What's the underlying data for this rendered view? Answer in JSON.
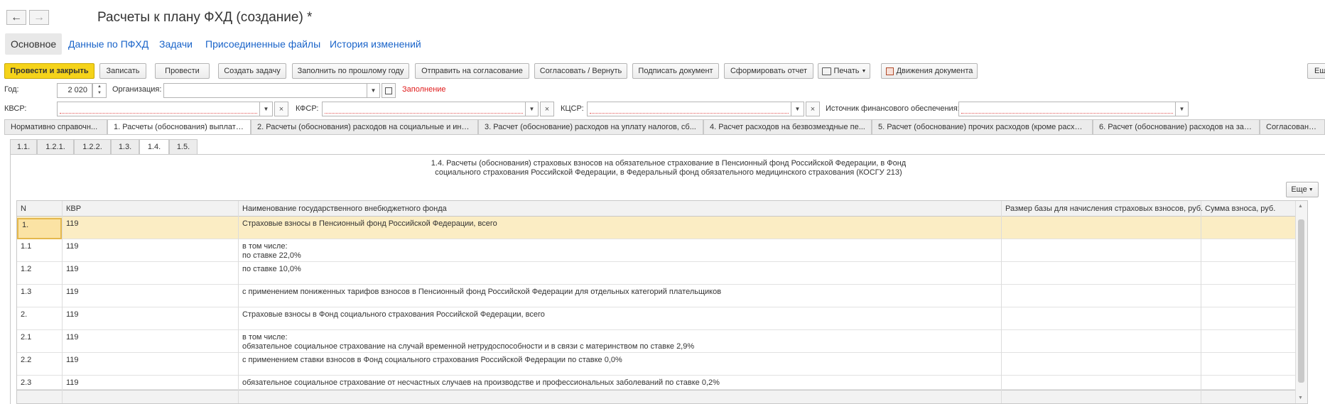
{
  "window": {
    "title": "Расчеты к плану ФХД (создание) *",
    "back_icon": "←",
    "forward_icon": "→"
  },
  "top_tabs": [
    "Основное",
    "Данные по ПФХД",
    "Задачи",
    "Присоединенные файлы",
    "История изменений"
  ],
  "toolbar": {
    "post_close": "Провести и закрыть",
    "save": "Записать",
    "post": "Провести",
    "create_task": "Создать задачу",
    "fill_prev_year": "Заполнить по прошлому году",
    "send_approval": "Отправить на согласование",
    "approve_return": "Согласовать / Вернуть",
    "sign": "Подписать документ",
    "report": "Сформировать отчет",
    "print": "Печать",
    "movements": "Движения документа",
    "more": "Ещ"
  },
  "fields": {
    "year_label": "Год:",
    "year_value": "2 020",
    "org_label": "Организация:",
    "org_value": "",
    "fill_link": "Заполнение",
    "kvsr_label": "КВСР:",
    "kfsr_label": "КФСР:",
    "kcsr_label": "КЦСР:",
    "source_label": "Источник финансового обеспечения:"
  },
  "section_tabs": [
    "Нормативно справочн...",
    "1. Расчеты (обоснования) выплат п...",
    "2. Расчеты (обоснования) расходов на социальные и ины...",
    "3. Расчет (обоснование) расходов на уплату налогов, сб...",
    "4. Расчет расходов на безвозмездные пе...",
    "5. Расчет (обоснование) прочих расходов (кроме расход...",
    "6. Расчет (обоснование) расходов на зак...",
    "Согласован поль..."
  ],
  "sub_tabs": [
    "1.1.",
    "1.2.1.",
    "1.2.2.",
    "1.3.",
    "1.4.",
    "1.5."
  ],
  "caption": {
    "line1": "1.4. Расчеты (обоснования) страховых взносов на обязательное страхование в Пенсионный фонд Российской Федерации, в Фонд",
    "line2": "социального страхования Российской Федерации, в Федеральный фонд обязательного медицинского страхования (КОСГУ 213)"
  },
  "more_button": "Еще",
  "table": {
    "columns": [
      "N",
      "КВР",
      "Наименование государственного внебюджетного фонда",
      "Размер базы для начисления страховых взносов, руб.",
      "Сумма взноса, руб."
    ],
    "rows": [
      {
        "n": "1.",
        "kvr": "119",
        "name": "Страховые взносы в Пенсионный фонд Российской Федерации, всего",
        "name2": ""
      },
      {
        "n": "1.1",
        "kvr": "119",
        "name": "в том числе:",
        "name2": "по ставке 22,0%"
      },
      {
        "n": "1.2",
        "kvr": "119",
        "name": "по ставке 10,0%",
        "name2": ""
      },
      {
        "n": "1.3",
        "kvr": "119",
        "name": "с применением пониженных тарифов взносов в Пенсионный фонд Российской Федерации для отдельных категорий плательщиков",
        "name2": ""
      },
      {
        "n": "2.",
        "kvr": "119",
        "name": "Страховые взносы в Фонд социального страхования Российской Федерации, всего",
        "name2": ""
      },
      {
        "n": "2.1",
        "kvr": "119",
        "name": "в том числе:",
        "name2": "обязательное социальное страхование на случай временной нетрудоспособности и в связи с материнством по ставке 2,9%"
      },
      {
        "n": "2.2",
        "kvr": "119",
        "name": "с применением ставки взносов в Фонд социального страхования Российской Федерации по ставке 0,0%",
        "name2": ""
      },
      {
        "n": "2.3",
        "kvr": "119",
        "name": "обязательное социальное страхование от несчастных случаев на производстве и профессиональных заболеваний по ставке 0,2%",
        "name2": ""
      }
    ]
  },
  "colors": {
    "primary_button": "#f5d31a",
    "link": "#1a64c9",
    "selected_row": "#fbedc4",
    "warning_text": "#e01b1b"
  }
}
